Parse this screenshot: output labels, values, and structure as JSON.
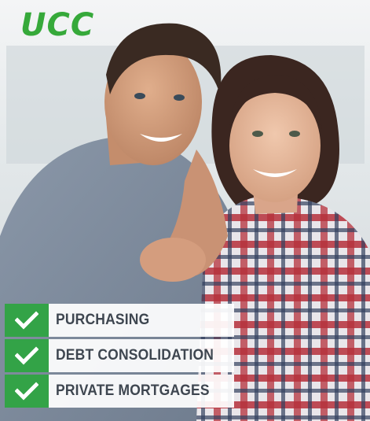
{
  "brand": {
    "logo_text": "UCC",
    "accent_color": "#36a93a"
  },
  "photo": {
    "subject": "couple-photo"
  },
  "features": [
    {
      "icon": "checkmark-icon",
      "label": "PURCHASING"
    },
    {
      "icon": "checkmark-icon",
      "label": "DEBT CONSOLIDATION"
    },
    {
      "icon": "checkmark-icon",
      "label": "PRIVATE MORTGAGES"
    }
  ],
  "colors": {
    "check_bg": "#33a347",
    "label_text": "#3e4650"
  }
}
